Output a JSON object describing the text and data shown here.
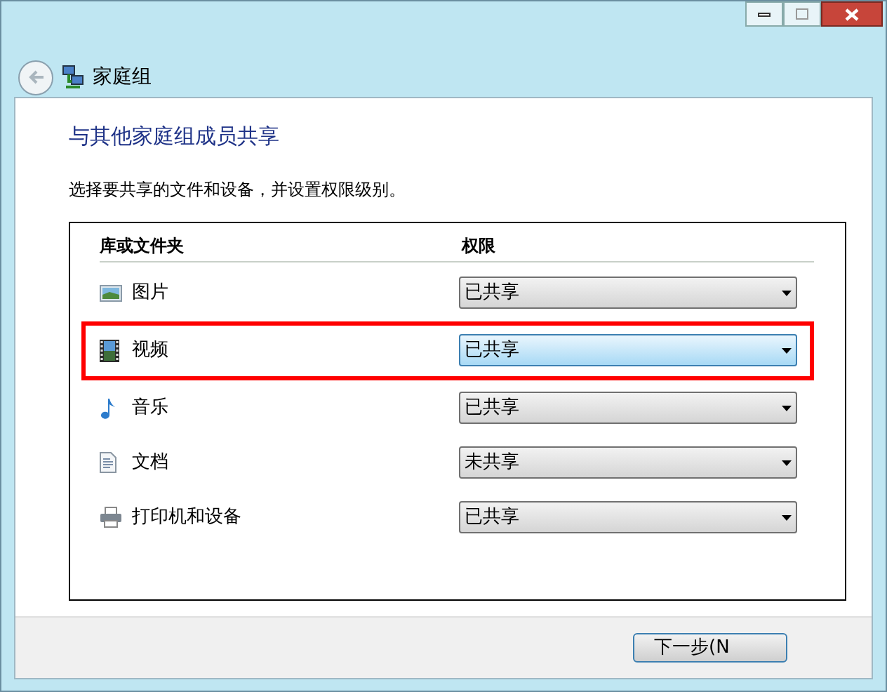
{
  "nav": {
    "title": "家庭组"
  },
  "heading": "与其他家庭组成员共享",
  "instruction": "选择要共享的文件和设备，并设置权限级别。",
  "table": {
    "columns": [
      "库或文件夹",
      "权限"
    ],
    "rows": [
      {
        "kind": "pictures",
        "name": "图片",
        "permission": "已共享",
        "highlighted": false
      },
      {
        "kind": "videos",
        "name": "视频",
        "permission": "已共享",
        "highlighted": true
      },
      {
        "kind": "music",
        "name": "音乐",
        "permission": "已共享",
        "highlighted": false
      },
      {
        "kind": "documents",
        "name": "文档",
        "permission": "未共享",
        "highlighted": false
      },
      {
        "kind": "printers",
        "name": "打印机和设备",
        "permission": "已共享",
        "highlighted": false
      }
    ]
  },
  "buttons": [
    "下一步(N"
  ]
}
